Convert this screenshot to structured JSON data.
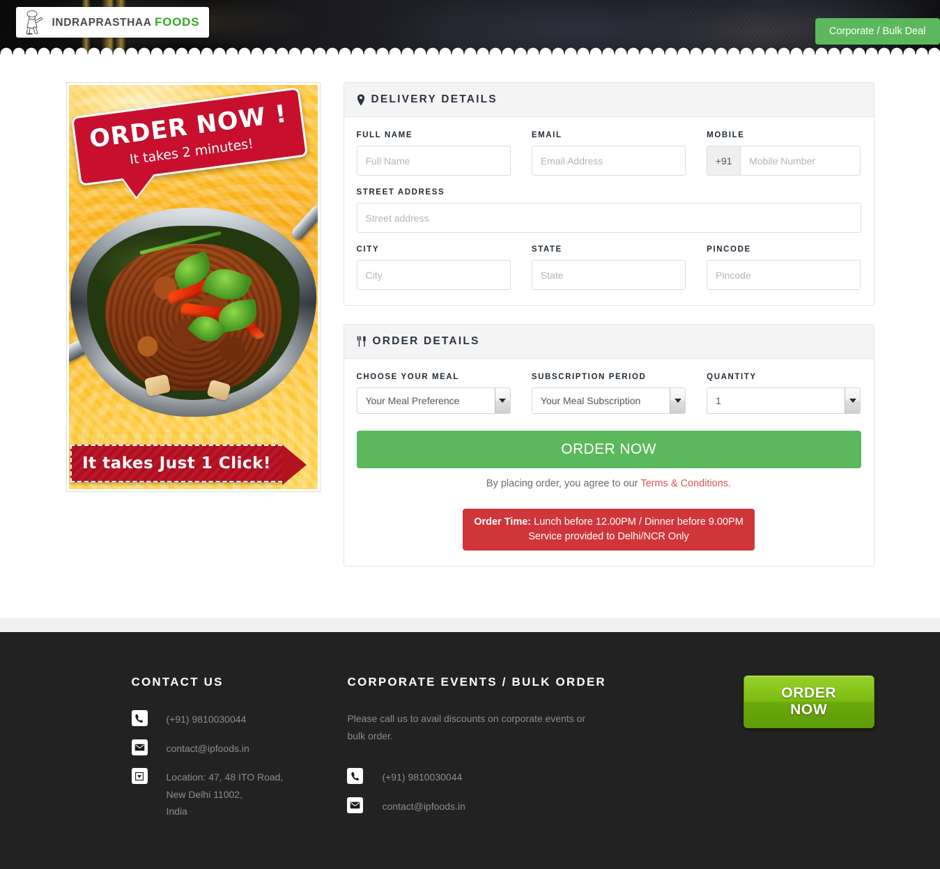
{
  "header": {
    "logo": {
      "line1": "INDRAPRASTHAA",
      "line2": "FOODS",
      "icon": "chef-logo-icon"
    },
    "corporate_button": "Corporate / Bulk Deal",
    "accent_green": "#5cb85c"
  },
  "promo": {
    "bubble_title": "ORDER NOW !",
    "bubble_subtitle": "It takes 2 minutes!",
    "ribbon_text": "It takes Just 1 Click!",
    "image_alt": "Indian curry in steel karahi bowl"
  },
  "delivery": {
    "title": "DELIVERY DETAILS",
    "icon": "map-pin-icon",
    "fields": {
      "full_name": {
        "label": "FULL NAME",
        "placeholder": "Full Name",
        "value": ""
      },
      "email": {
        "label": "EMAIL",
        "placeholder": "Email Address",
        "value": ""
      },
      "mobile": {
        "label": "MOBILE",
        "placeholder": "Mobile Number",
        "prefix": "+91",
        "value": ""
      },
      "street": {
        "label": "STREET ADDRESS",
        "placeholder": "Street address",
        "value": ""
      },
      "city": {
        "label": "CITY",
        "placeholder": "City",
        "value": ""
      },
      "state": {
        "label": "STATE",
        "placeholder": "State",
        "value": ""
      },
      "pincode": {
        "label": "PINCODE",
        "placeholder": "Pincode",
        "value": ""
      }
    }
  },
  "order": {
    "title": "ORDER DETAILS",
    "icon": "cutlery-icon",
    "meal": {
      "label": "CHOOSE YOUR MEAL",
      "selected": "Your Meal Preference"
    },
    "subscription": {
      "label": "SUBSCRIPTION PERIOD",
      "selected": "Your Meal Subscription"
    },
    "quantity": {
      "label": "QUANTITY",
      "selected": "1"
    },
    "submit_button": "ORDER NOW",
    "terms_prefix": "By placing order, you agree to our ",
    "terms_link": "Terms & Conditions.",
    "notice": {
      "label": "Order Time:",
      "line1": " Lunch before 12.00PM / Dinner before 9.00PM",
      "line2": "Service provided to Delhi/NCR Only",
      "color": "#d0353a"
    }
  },
  "footer": {
    "contact": {
      "title": "CONTACT US",
      "phone": "(+91) 9810030044",
      "email": "contact@ipfoods.in",
      "address_line1": "Location: 47, 48 ITO Road,",
      "address_line2": "New Delhi 11002,",
      "address_line3": "India"
    },
    "corporate": {
      "title": "CORPORATE EVENTS / BULK ORDER",
      "description": "Please call us to avail discounts on corporate events or bulk order.",
      "phone": "(+91) 9810030044",
      "email": "contact@ipfoods.in"
    },
    "order_button": "ORDER NOW"
  }
}
